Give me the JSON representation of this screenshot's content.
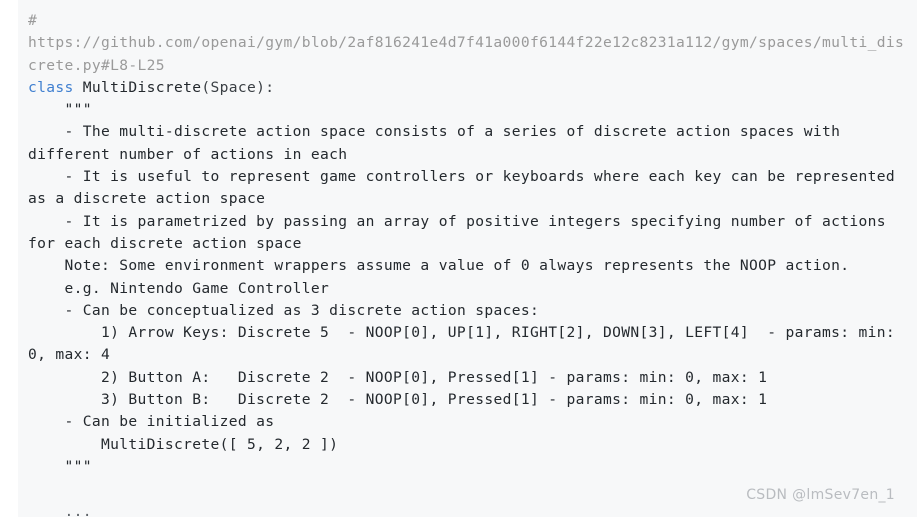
{
  "viewer": {
    "language": "python",
    "background_color": "#f7f8f9",
    "page_background_color": "#ffffff"
  },
  "colors": {
    "comment": "#9a9a9a",
    "keyword": "#3f7fd0",
    "class_name": "#1aa39a",
    "plain": "#3a3f44",
    "docstring": "#e8555f",
    "ellipsis": "#5d6368",
    "watermark": "#b9bcc0"
  },
  "code": {
    "lines": [
      {
        "id": "line-comment-url",
        "segments": [
          {
            "token": "comment",
            "text": "# https://github.com/openai/gym/blob/2af816241e4d7f41a000f6144f22e12c8231a112/gym/spaces/multi_discrete.py#L8-L25"
          }
        ]
      },
      {
        "id": "line-class-def",
        "segments": [
          {
            "token": "keyword",
            "text": "class "
          },
          {
            "token": "class_name",
            "text": "MultiDiscrete"
          },
          {
            "token": "plain",
            "text": "(Space):"
          }
        ]
      },
      {
        "id": "line-docstring-open",
        "segments": [
          {
            "token": "docstring",
            "text": "    \"\"\""
          }
        ]
      },
      {
        "id": "line-doc-1",
        "segments": [
          {
            "token": "docstring",
            "text": "    - The multi-discrete action space consists of a series of discrete action spaces with different number of actions in each"
          }
        ]
      },
      {
        "id": "line-doc-2",
        "segments": [
          {
            "token": "docstring",
            "text": "    - It is useful to represent game controllers or keyboards where each key can be represented as a discrete action space"
          }
        ]
      },
      {
        "id": "line-doc-3",
        "segments": [
          {
            "token": "docstring",
            "text": "    - It is parametrized by passing an array of positive integers specifying number of actions for each discrete action space"
          }
        ]
      },
      {
        "id": "line-doc-note",
        "segments": [
          {
            "token": "docstring",
            "text": "    Note: Some environment wrappers assume a value of 0 always represents the NOOP action."
          }
        ]
      },
      {
        "id": "line-doc-eg",
        "segments": [
          {
            "token": "docstring",
            "text": "    e.g. Nintendo Game Controller"
          }
        ]
      },
      {
        "id": "line-doc-concept",
        "segments": [
          {
            "token": "docstring",
            "text": "    - Can be conceptualized as 3 discrete action spaces:"
          }
        ]
      },
      {
        "id": "line-doc-arrow-keys",
        "segments": [
          {
            "token": "docstring",
            "text": "        1) Arrow Keys: Discrete 5  - NOOP[0], UP[1], RIGHT[2], DOWN[3], LEFT[4]  - params: min: 0, max: 4"
          }
        ]
      },
      {
        "id": "line-doc-button-a",
        "segments": [
          {
            "token": "docstring",
            "text": "        2) Button A:   Discrete 2  - NOOP[0], Pressed[1] - params: min: 0, max: 1"
          }
        ]
      },
      {
        "id": "line-doc-button-b",
        "segments": [
          {
            "token": "docstring",
            "text": "        3) Button B:   Discrete 2  - NOOP[0], Pressed[1] - params: min: 0, max: 1"
          }
        ]
      },
      {
        "id": "line-doc-init",
        "segments": [
          {
            "token": "docstring",
            "text": "    - Can be initialized as"
          }
        ]
      },
      {
        "id": "line-doc-init-call",
        "segments": [
          {
            "token": "docstring",
            "text": "        MultiDiscrete([ 5, 2, 2 ])"
          }
        ]
      },
      {
        "id": "line-docstring-close",
        "segments": [
          {
            "token": "docstring",
            "text": "    \"\"\""
          }
        ]
      },
      {
        "id": "line-blank",
        "segments": [
          {
            "token": "plain",
            "text": " "
          }
        ]
      },
      {
        "id": "line-ellipsis",
        "segments": [
          {
            "token": "ellipsis",
            "text": "    ..."
          }
        ]
      }
    ]
  },
  "watermark": {
    "text": "CSDN @lmSev7en_1"
  }
}
